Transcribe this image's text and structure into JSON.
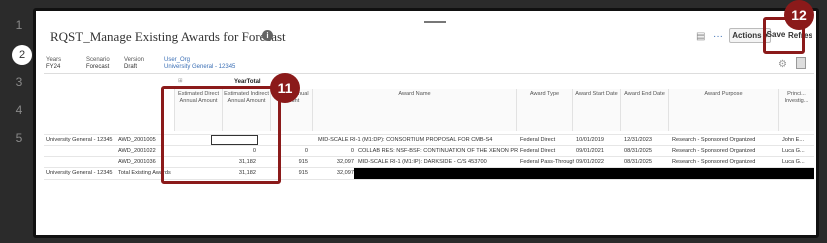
{
  "steps": [
    "1",
    "2",
    "3",
    "4",
    "5"
  ],
  "title": "RQST_Manage Existing Awards for Forecast",
  "toolbar": {
    "actions_label": "Actions",
    "save_label": "Save",
    "refresh_label": "Refresh",
    "more_label": "···"
  },
  "pov": [
    {
      "label": "Years",
      "value": "FY24"
    },
    {
      "label": "Scenario",
      "value": "Forecast"
    },
    {
      "label": "Version",
      "value": "Draft"
    },
    {
      "label": "User_Org",
      "value": "University General - 12345"
    }
  ],
  "grid": {
    "year_total": "YearTotal",
    "columns": [
      "Estimated Direct Annual Amount",
      "Estimated Indirect Annual Amount",
      "...ated Annual ...ount",
      "Award Name",
      "Award Type",
      "Award Start Date",
      "Award End Date",
      "Award Purpose",
      "Princi... Investig..."
    ],
    "rows": [
      {
        "org": "University General - 12345",
        "award": "AWD_2001005",
        "direct": "",
        "indirect": "",
        "total": "",
        "name": "MID-SCALE RI-1 (M1:DP): CONSORTIUM PROPOSAL FOR CMB-S4",
        "type": "Federal Direct",
        "start": "10/01/2019",
        "end": "12/31/2023",
        "purpose": "Research - Sponsored Organized",
        "pi": "John E..."
      },
      {
        "org": "",
        "award": "AWD_2001022",
        "direct": "0",
        "indirect": "0",
        "total": "0",
        "name": "COLLAB RES: NSF-BSF: CONTINUATION OF THE XENON PROGRAM",
        "type": "Federal Direct",
        "start": "09/01/2021",
        "end": "08/31/2025",
        "purpose": "Research - Sponsored Organized",
        "pi": "Luca G..."
      },
      {
        "org": "",
        "award": "AWD_2001036",
        "direct": "31,182",
        "indirect": "915",
        "total": "32,097",
        "name": "MID-SCALE RI-1 (M1:IP): DARKSIDE - C/S 453700",
        "type": "Federal Pass-Through",
        "start": "09/01/2022",
        "end": "08/31/2025",
        "purpose": "Research - Sponsored Organized",
        "pi": "Luca G..."
      },
      {
        "org": "University General - 12345",
        "award": "Total Existing Awards",
        "direct": "31,182",
        "indirect": "915",
        "total": "32,097",
        "name": "",
        "type": "",
        "start": "",
        "end": "",
        "purpose": "",
        "pi": ""
      }
    ]
  },
  "callouts": {
    "grid_badge": "11",
    "save_badge": "12"
  },
  "colors": {
    "callout": "#8b1a1a",
    "link": "#3b6fb5"
  }
}
